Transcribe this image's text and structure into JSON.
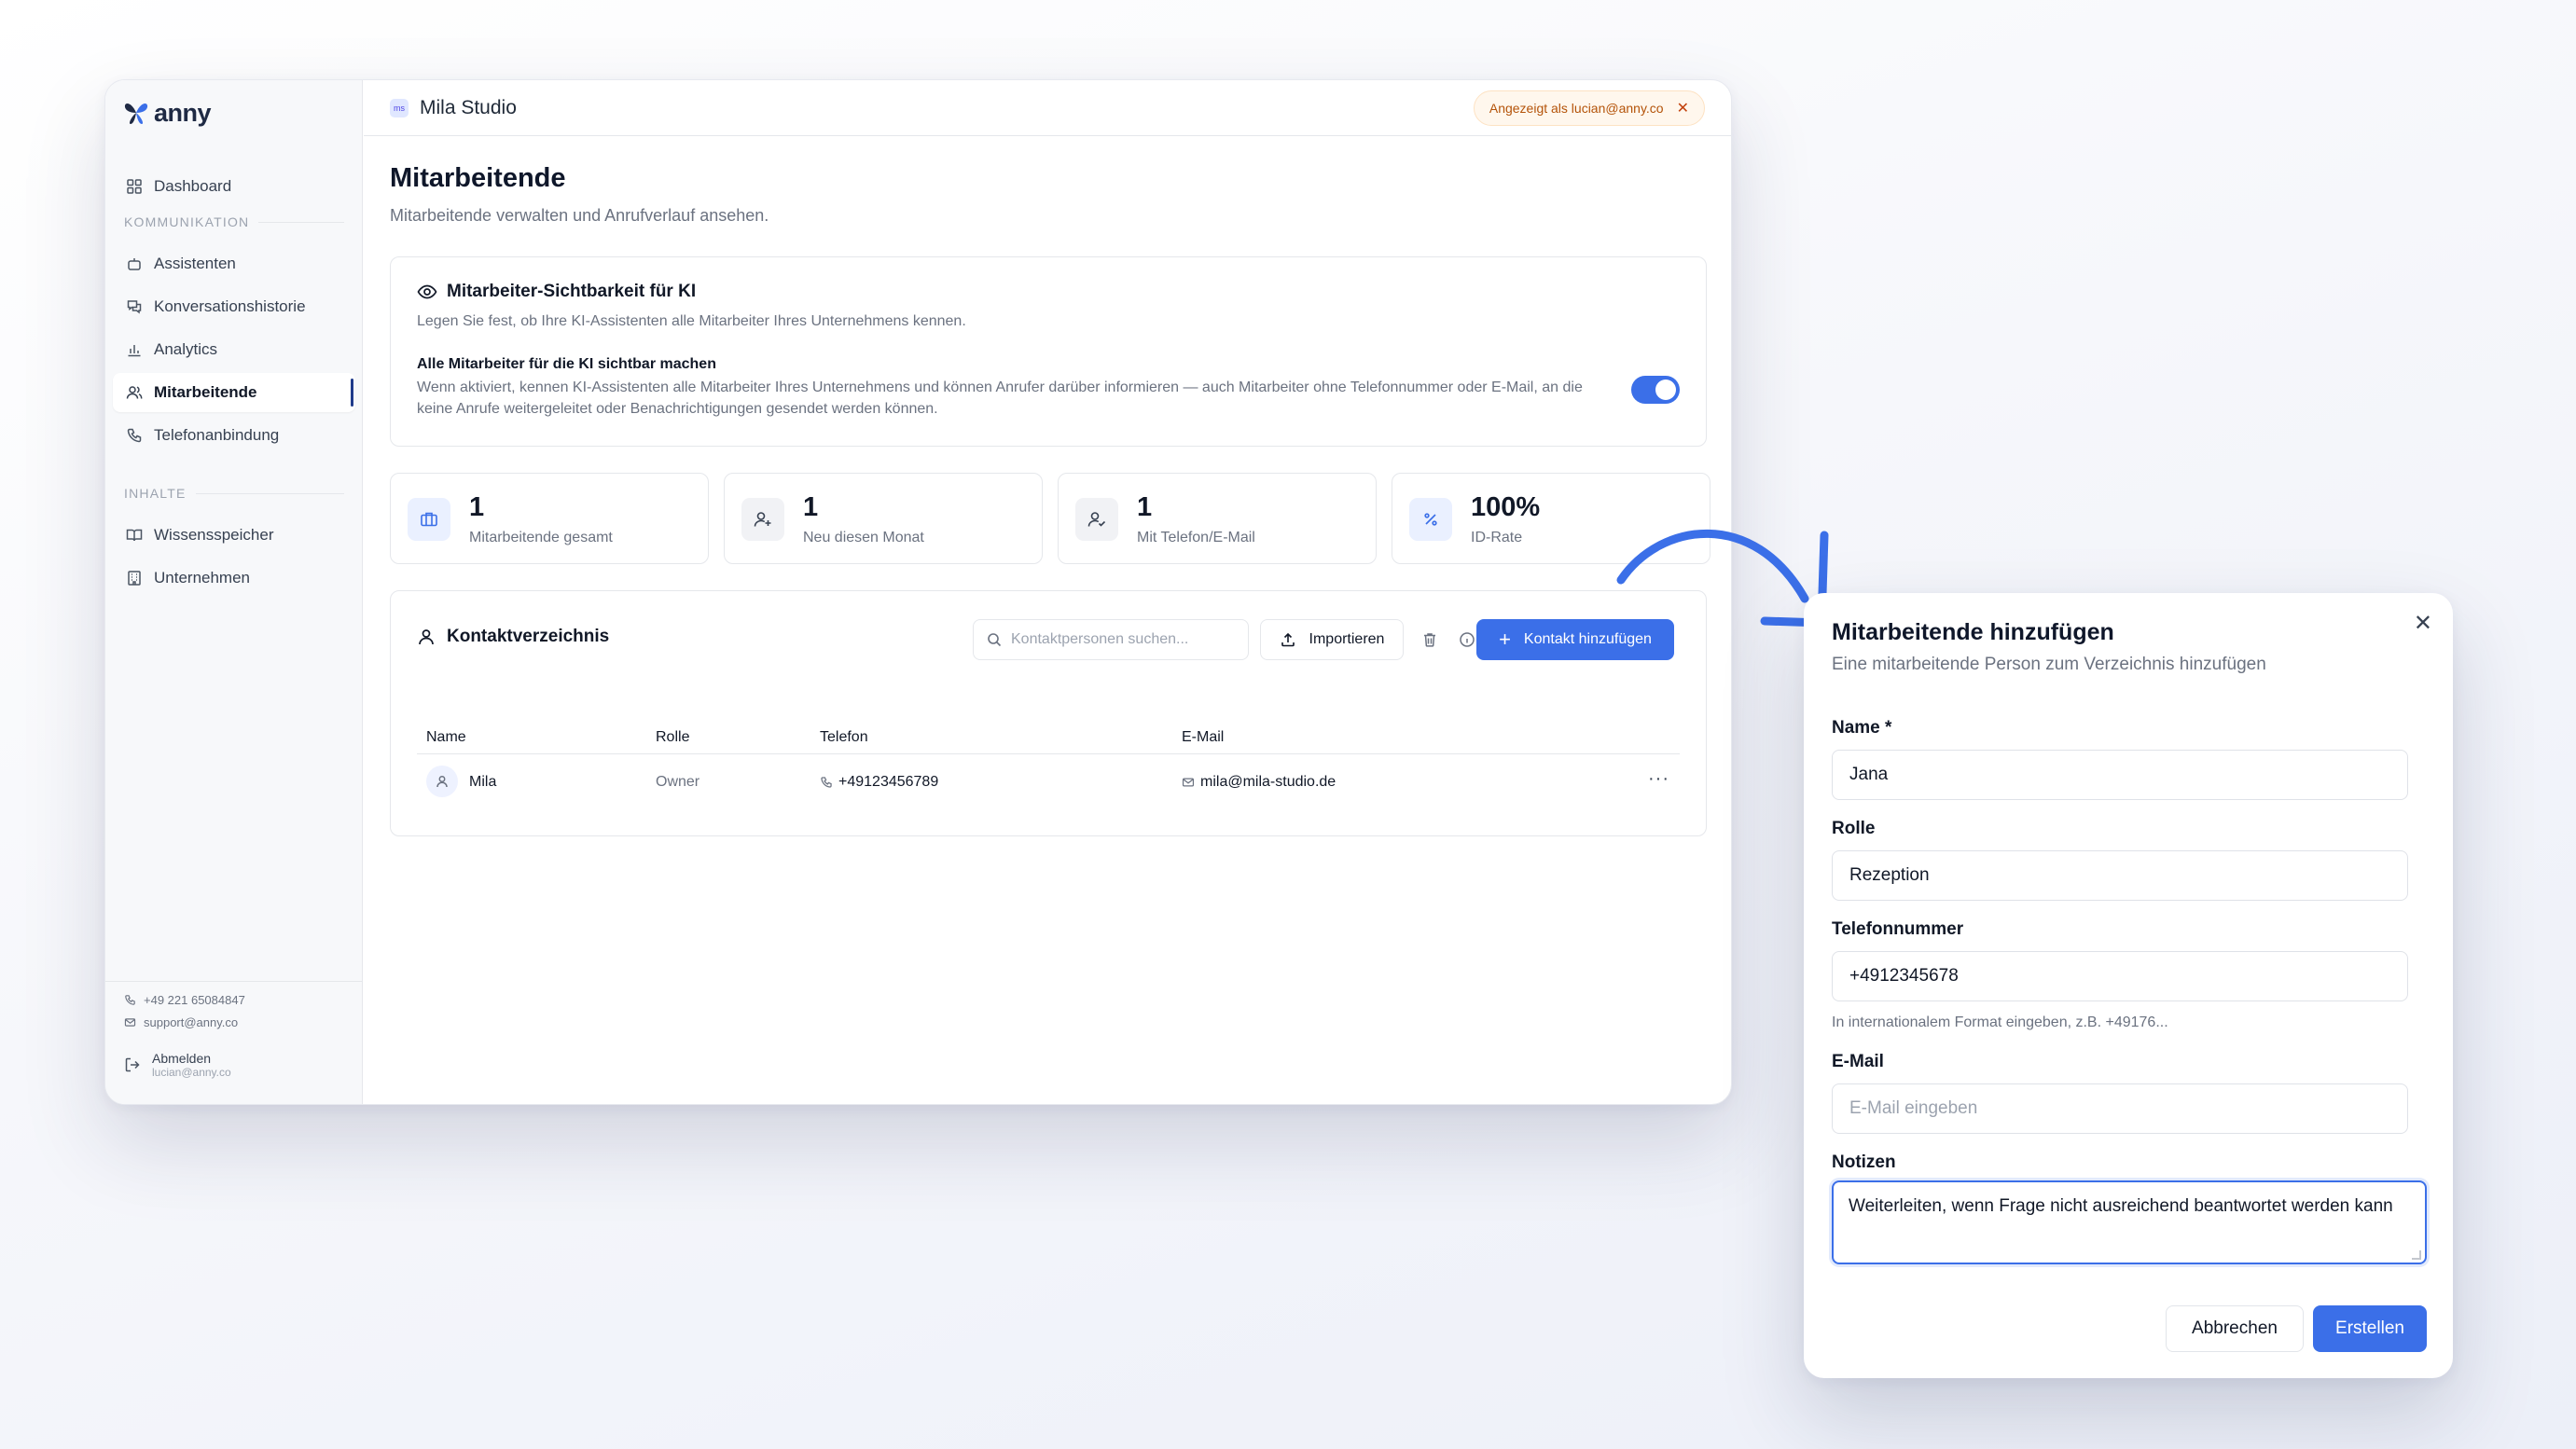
{
  "sidebar": {
    "logo": "anny",
    "dashboard": "Dashboard",
    "section_kommunikation": "KOMMUNIKATION",
    "items_kommunikation": [
      "Assistenten",
      "Konversationshistorie",
      "Analytics",
      "Mitarbeitende",
      "Telefonanbindung"
    ],
    "section_inhalte": "INHALTE",
    "items_inhalte": [
      "Wissensspeicher",
      "Unternehmen"
    ],
    "footer_phone": "+49 221 65084847",
    "footer_email": "support@anny.co",
    "logout_label": "Abmelden",
    "logout_user": "lucian@anny.co"
  },
  "topbar": {
    "studio_name": "Mila Studio",
    "studio_initials": "ms",
    "shown_as": "Angezeigt als lucian@anny.co",
    "close_glyph": "✕"
  },
  "page": {
    "title": "Mitarbeitende",
    "subtitle": "Mitarbeitende verwalten und Anrufverlauf ansehen."
  },
  "visibility": {
    "title": "Mitarbeiter-Sichtbarkeit für KI",
    "description": "Legen Sie fest, ob Ihre KI-Assistenten alle Mitarbeiter Ihres Unternehmens kennen.",
    "option_title": "Alle Mitarbeiter für die KI sichtbar machen",
    "option_description": "Wenn aktiviert, kennen KI-Assistenten alle Mitarbeiter Ihres Unternehmens und können Anrufer darüber informieren — auch Mitarbeiter ohne Telefonnummer oder E-Mail, an die keine Anrufe weitergeleitet oder Benachrichtigungen gesendet werden können.",
    "toggle_on": true
  },
  "stats": [
    {
      "value": "1",
      "label": "Mitarbeitende gesamt",
      "icon": "briefcase-icon"
    },
    {
      "value": "1",
      "label": "Neu diesen Monat",
      "icon": "user-plus-icon"
    },
    {
      "value": "1",
      "label": "Mit Telefon/E-Mail",
      "icon": "user-check-icon"
    },
    {
      "value": "100%",
      "label": "ID-Rate",
      "icon": "percent-icon"
    }
  ],
  "contacts": {
    "title": "Kontaktverzeichnis",
    "search_placeholder": "Kontaktpersonen suchen...",
    "import_label": "Importieren",
    "add_label": "Kontakt hinzufügen",
    "columns": [
      "Name",
      "Rolle",
      "Telefon",
      "E-Mail"
    ],
    "rows": [
      {
        "name": "Mila",
        "role": "Owner",
        "phone": "+49123456789",
        "email": "mila@mila-studio.de"
      }
    ],
    "more_glyph": "···"
  },
  "modal": {
    "title": "Mitarbeitende hinzufügen",
    "subtitle": "Eine mitarbeitende Person zum Verzeichnis hinzufügen",
    "close_glyph": "✕",
    "name_label": "Name *",
    "name_value": "Jana",
    "role_label": "Rolle",
    "role_value": "Rezeption",
    "phone_label": "Telefonnummer",
    "phone_value": "+4912345678",
    "phone_hint": "In internationalem Format eingeben, z.B. +49176...",
    "email_label": "E-Mail",
    "email_placeholder": "E-Mail eingeben",
    "notes_label": "Notizen",
    "notes_value": "Weiterleiten, wenn Frage nicht ausreichend beantwortet werden kann",
    "cancel_label": "Abbrechen",
    "create_label": "Erstellen"
  },
  "colors": {
    "accent": "#3b6fe8",
    "nav_active_bar": "#1e3a8a",
    "badge_bg": "#fff7ed",
    "badge_text": "#b45309"
  }
}
